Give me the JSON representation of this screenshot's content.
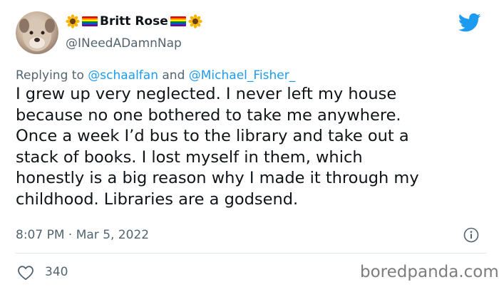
{
  "author": {
    "display_name": "Britt Rose",
    "handle": "@INeedADamnNap",
    "avatar_icon": "dog-avatar"
  },
  "reply": {
    "prefix": "Replying to ",
    "mention_1": "@schaalfan",
    "conjunction": " and ",
    "mention_2": "@Michael_Fisher_"
  },
  "tweet": {
    "lines": [
      "I grew up very neglected. I never left my house",
      "because no one bothered to take me anywhere.",
      "Once a week I’d bus to the library and take out a",
      "stack of books. I lost myself in them, which",
      "honestly is a big reason why I made it through my",
      "childhood. Libraries are a godsend."
    ]
  },
  "meta": {
    "timestamp": "8:07 PM · Mar 5, 2022"
  },
  "engagement": {
    "likes": "340"
  },
  "watermark": "boredpanda.com",
  "colors": {
    "twitter_blue": "#1d9bf0",
    "secondary_text": "#536471",
    "primary_text": "#0f1419"
  },
  "icons": [
    "sunflower-icon",
    "rainbow-flag-icon",
    "twitter-bird-icon",
    "info-icon",
    "heart-icon"
  ]
}
